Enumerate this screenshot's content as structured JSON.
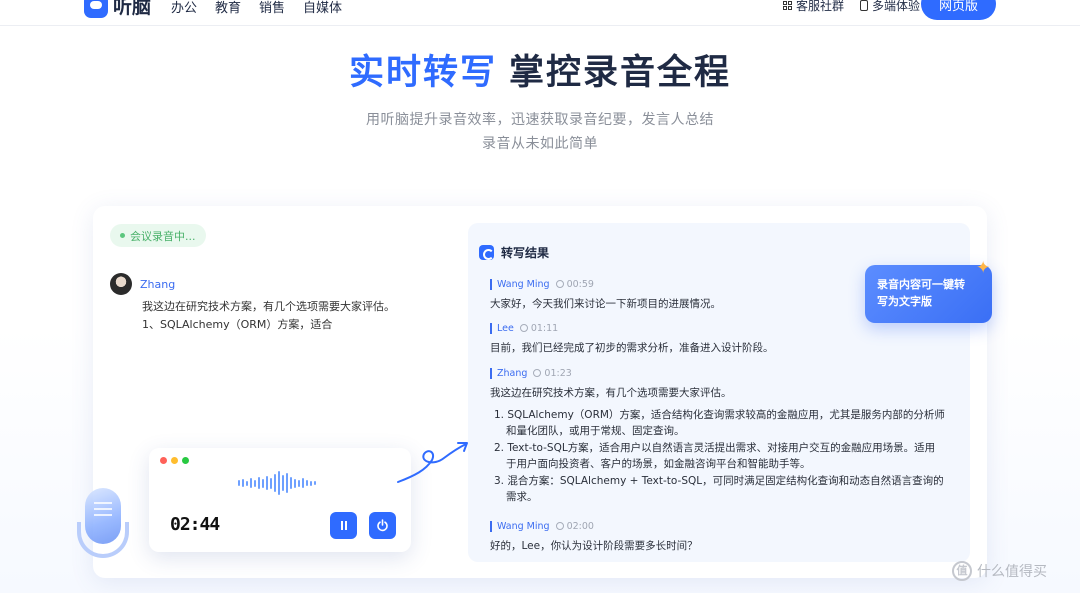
{
  "nav": {
    "logo_text": "听脑",
    "links": [
      "办公",
      "教育",
      "销售",
      "自媒体"
    ],
    "customer_group": "客服社群",
    "multi_device": "多端体验",
    "web_button": "网页版"
  },
  "hero": {
    "title_accent": "实时转写",
    "title_rest": "掌控录音全程",
    "subtitle_line1": "用听脑提升录音效率，迅速获取录音纪要，发言人总结",
    "subtitle_line2": "录音从未如此简单"
  },
  "recording": {
    "status": "会议录音中...",
    "speaker": "Zhang",
    "lines": [
      "我这边在研究技术方案，有几个选项需要大家评估。",
      "1、SQLAlchemy（ORM）方案，适合"
    ],
    "timer": "02:44",
    "pause_icon": "pause-icon",
    "power_icon": "power-icon"
  },
  "transcript": {
    "title": "转写结果",
    "segments": [
      {
        "name": "Wang Ming",
        "time": "00:59",
        "text": "大家好，今天我们来讨论一下新项目的进展情况。"
      },
      {
        "name": "Lee",
        "time": "01:11",
        "text": "目前，我们已经完成了初步的需求分析，准备进入设计阶段。"
      },
      {
        "name": "Zhang",
        "time": "01:23",
        "text": "我这边在研究技术方案，有几个选项需要大家评估。",
        "items": [
          "1. SQLAlchemy（ORM）方案，适合结构化查询需求较高的金融应用，尤其是服务内部的分析师和量化团队，或用于常规、固定查询。",
          "2. Text-to-SQL方案，适合用户以自然语言灵活提出需求、对接用户交互的金融应用场景。适用于用户面向投资者、客户的场景，如金融咨询平台和智能助手等。",
          "3. 混合方案：SQLAlchemy + Text-to-SQL，可同时满足固定结构化查询和动态自然语言查询的需求。"
        ]
      },
      {
        "name": "Wang Ming",
        "time": "02:00",
        "text": "好的，Lee，你认为设计阶段需要多长时间？"
      }
    ]
  },
  "bubble": {
    "line1": "录音内容可一键转",
    "line2": "写为文字版"
  },
  "watermark": {
    "icon_text": "值",
    "text": "什么值得买"
  },
  "colors": {
    "accent": "#2f6bff",
    "status_green": "#47b068"
  }
}
